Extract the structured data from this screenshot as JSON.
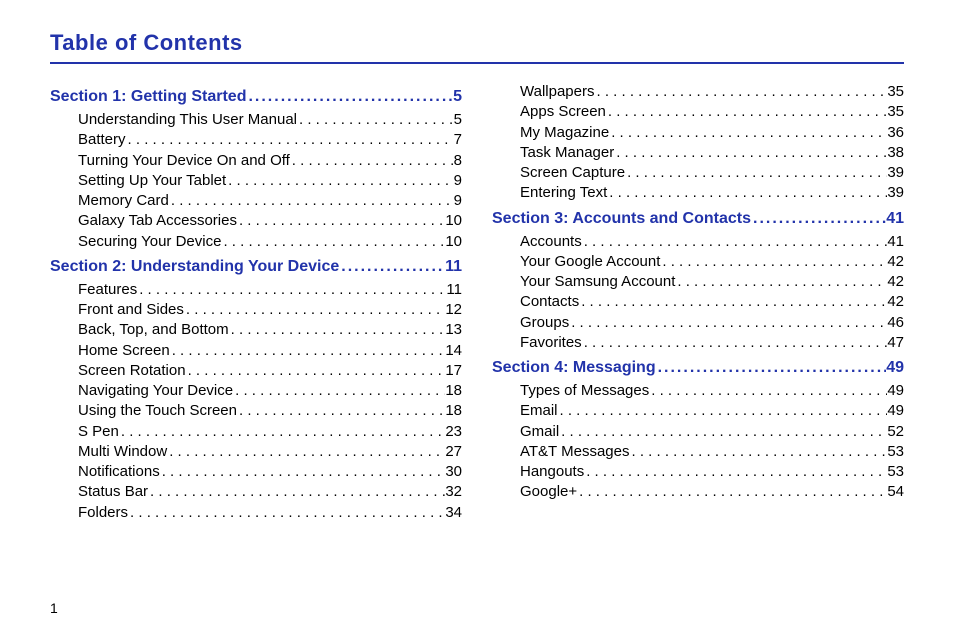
{
  "title": "Table of Contents",
  "page_number": "1",
  "columns": [
    {
      "items": [
        {
          "type": "section",
          "label": "Section 1:  Getting Started",
          "page": "5"
        },
        {
          "type": "entry",
          "label": "Understanding This User Manual",
          "page": "5"
        },
        {
          "type": "entry",
          "label": "Battery",
          "page": "7"
        },
        {
          "type": "entry",
          "label": "Turning Your Device On and Off",
          "page": "8"
        },
        {
          "type": "entry",
          "label": "Setting Up Your Tablet",
          "page": "9"
        },
        {
          "type": "entry",
          "label": "Memory Card",
          "page": "9"
        },
        {
          "type": "entry",
          "label": "Galaxy Tab Accessories",
          "page": "10"
        },
        {
          "type": "entry",
          "label": "Securing Your Device",
          "page": "10"
        },
        {
          "type": "section",
          "label": "Section 2:  Understanding Your Device",
          "page": "11"
        },
        {
          "type": "entry",
          "label": "Features",
          "page": "11"
        },
        {
          "type": "entry",
          "label": "Front and Sides",
          "page": "12"
        },
        {
          "type": "entry",
          "label": "Back, Top, and Bottom",
          "page": "13"
        },
        {
          "type": "entry",
          "label": "Home Screen",
          "page": "14"
        },
        {
          "type": "entry",
          "label": "Screen Rotation",
          "page": "17"
        },
        {
          "type": "entry",
          "label": "Navigating Your Device",
          "page": "18"
        },
        {
          "type": "entry",
          "label": "Using the Touch Screen",
          "page": "18"
        },
        {
          "type": "entry",
          "label": "S Pen",
          "page": "23"
        },
        {
          "type": "entry",
          "label": "Multi Window",
          "page": "27"
        },
        {
          "type": "entry",
          "label": "Notifications",
          "page": "30"
        },
        {
          "type": "entry",
          "label": "Status Bar",
          "page": "32"
        },
        {
          "type": "entry",
          "label": "Folders",
          "page": "34"
        }
      ]
    },
    {
      "items": [
        {
          "type": "entry",
          "label": "Wallpapers",
          "page": "35"
        },
        {
          "type": "entry",
          "label": "Apps Screen",
          "page": "35"
        },
        {
          "type": "entry",
          "label": "My Magazine",
          "page": "36"
        },
        {
          "type": "entry",
          "label": "Task Manager",
          "page": "38"
        },
        {
          "type": "entry",
          "label": "Screen Capture",
          "page": "39"
        },
        {
          "type": "entry",
          "label": "Entering Text",
          "page": "39"
        },
        {
          "type": "section",
          "label": "Section 3:  Accounts and Contacts",
          "page": "41"
        },
        {
          "type": "entry",
          "label": "Accounts",
          "page": "41"
        },
        {
          "type": "entry",
          "label": "Your Google Account",
          "page": "42"
        },
        {
          "type": "entry",
          "label": "Your Samsung Account",
          "page": "42"
        },
        {
          "type": "entry",
          "label": "Contacts",
          "page": "42"
        },
        {
          "type": "entry",
          "label": "Groups",
          "page": "46"
        },
        {
          "type": "entry",
          "label": "Favorites",
          "page": "47"
        },
        {
          "type": "section",
          "label": "Section 4:  Messaging",
          "page": "49"
        },
        {
          "type": "entry",
          "label": "Types of Messages",
          "page": "49"
        },
        {
          "type": "entry",
          "label": "Email",
          "page": "49"
        },
        {
          "type": "entry",
          "label": "Gmail",
          "page": "52"
        },
        {
          "type": "entry",
          "label": "AT&T Messages",
          "page": "53"
        },
        {
          "type": "entry",
          "label": "Hangouts",
          "page": "53"
        },
        {
          "type": "entry",
          "label": "Google+",
          "page": "54"
        }
      ]
    }
  ]
}
